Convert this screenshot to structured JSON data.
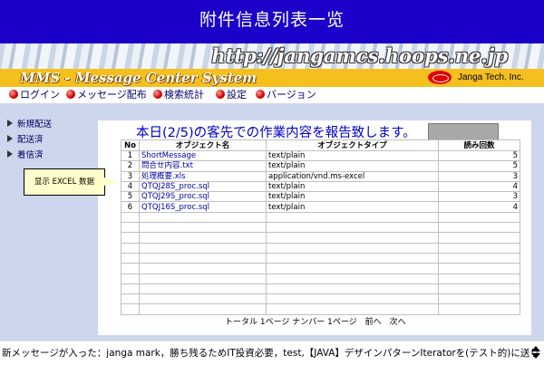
{
  "slide": {
    "title": "附件信息列表一览"
  },
  "banner": {
    "url": "http://jangamcs.hoops.ne.jp"
  },
  "header": {
    "app_title": "MMS - Message Center System",
    "company": "Janga Tech. Inc."
  },
  "nav": [
    {
      "label": "ログイン"
    },
    {
      "label": "メッセージ配布"
    },
    {
      "label": "検索統計"
    },
    {
      "label": "設定"
    },
    {
      "label": "バージョン"
    }
  ],
  "sidebar": [
    {
      "label": "新規配送"
    },
    {
      "label": "配送済"
    },
    {
      "label": "着信済"
    }
  ],
  "report": {
    "heading": "本日(2/5)の客先での作業内容を報告致します。",
    "columns": [
      "No",
      "オブジェクト名",
      "オブジェクトタイプ",
      "読み回数"
    ],
    "rows": [
      {
        "no": "1",
        "name": "ShortMessage",
        "type": "text/plain",
        "count": "5"
      },
      {
        "no": "2",
        "name": "問合せ内容.txt",
        "type": "text/plain",
        "count": "5"
      },
      {
        "no": "3",
        "name": "処理概要.xls",
        "type": "application/vnd.ms-excel",
        "count": "3"
      },
      {
        "no": "4",
        "name": "QTQJ28S_proc.sql",
        "type": "text/plain",
        "count": "4"
      },
      {
        "no": "5",
        "name": "QTQJ29S_proc.sql",
        "type": "text/plain",
        "count": "3"
      },
      {
        "no": "6",
        "name": "QTQJ16S_proc.sql",
        "type": "text/plain",
        "count": "4"
      }
    ],
    "pager": "トータル 1ページ ナンバー 1ページ　前へ　次へ"
  },
  "callout": {
    "text": "显示 EXCEL 数据"
  },
  "ticker": {
    "text": "新メッセージが入った：janga mark，勝ち残るためIT投資必要，test,【JAVA】デザインパターンIteratorを(テスト的)に送り"
  },
  "colors": {
    "title_bg": "#1a00c8",
    "header_bg": "#f5bf1e",
    "content_bg": "#ccd6ec",
    "link": "#0000aa",
    "heading": "#0000cc"
  }
}
